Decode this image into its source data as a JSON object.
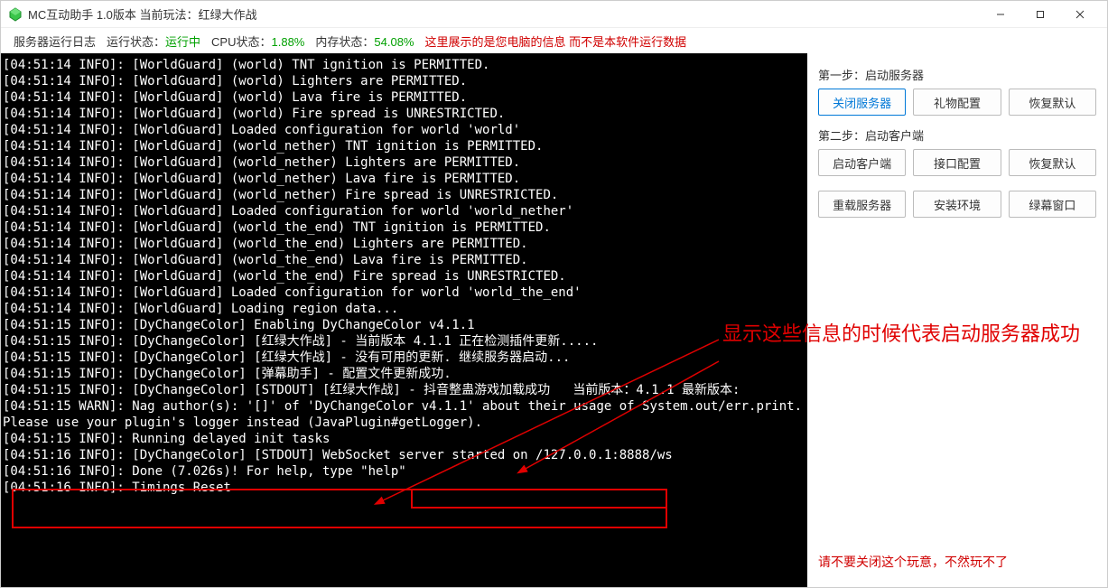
{
  "titlebar": {
    "title": "MC互动助手 1.0版本 当前玩法：红绿大作战"
  },
  "status": {
    "log_title": "服务器运行日志",
    "run_state_label": "运行状态：",
    "run_state_value": "运行中",
    "cpu_label": "CPU状态：",
    "cpu_value": "1.88%",
    "mem_label": "内存状态：",
    "mem_value": "54.08%",
    "notice": "这里展示的是您电脑的信息 而不是本软件运行数据"
  },
  "console_lines": [
    "[04:51:14 INFO]: [WorldGuard] (world) TNT ignition is PERMITTED.",
    "[04:51:14 INFO]: [WorldGuard] (world) Lighters are PERMITTED.",
    "[04:51:14 INFO]: [WorldGuard] (world) Lava fire is PERMITTED.",
    "[04:51:14 INFO]: [WorldGuard] (world) Fire spread is UNRESTRICTED.",
    "[04:51:14 INFO]: [WorldGuard] Loaded configuration for world 'world'",
    "[04:51:14 INFO]: [WorldGuard] (world_nether) TNT ignition is PERMITTED.",
    "[04:51:14 INFO]: [WorldGuard] (world_nether) Lighters are PERMITTED.",
    "[04:51:14 INFO]: [WorldGuard] (world_nether) Lava fire is PERMITTED.",
    "[04:51:14 INFO]: [WorldGuard] (world_nether) Fire spread is UNRESTRICTED.",
    "[04:51:14 INFO]: [WorldGuard] Loaded configuration for world 'world_nether'",
    "[04:51:14 INFO]: [WorldGuard] (world_the_end) TNT ignition is PERMITTED.",
    "[04:51:14 INFO]: [WorldGuard] (world_the_end) Lighters are PERMITTED.",
    "[04:51:14 INFO]: [WorldGuard] (world_the_end) Lava fire is PERMITTED.",
    "[04:51:14 INFO]: [WorldGuard] (world_the_end) Fire spread is UNRESTRICTED.",
    "[04:51:14 INFO]: [WorldGuard] Loaded configuration for world 'world_the_end'",
    "[04:51:14 INFO]: [WorldGuard] Loading region data...",
    "[04:51:15 INFO]: [DyChangeColor] Enabling DyChangeColor v4.1.1",
    "[04:51:15 INFO]: [DyChangeColor] [红绿大作战] - 当前版本 4.1.1 正在检测插件更新.....",
    "[04:51:15 INFO]: [DyChangeColor] [红绿大作战] - 没有可用的更新. 继续服务器启动...",
    "[04:51:15 INFO]: [DyChangeColor] [弹幕助手] - 配置文件更新成功.",
    "[04:51:15 INFO]: [DyChangeColor] [STDOUT] [红绿大作战] - 抖音整蛊游戏加载成功   当前版本：4.1.1 最新版本:",
    "[04:51:15 WARN]: Nag author(s): '[]' of 'DyChangeColor v4.1.1' about their usage of System.out/err.print.",
    "Please use your plugin's logger instead (JavaPlugin#getLogger).",
    "[04:51:15 INFO]: Running delayed init tasks",
    "[04:51:16 INFO]: [DyChangeColor] [STDOUT] WebSocket server started on /127.0.0.1:8888/ws",
    "[04:51:16 INFO]: Done (7.026s)! For help, type \"help\"",
    "[04:51:16 INFO]: Timings Reset"
  ],
  "sidebar": {
    "step1_label": "第一步：启动服务器",
    "step2_label": "第二步：启动客户端",
    "row1": {
      "b1": "关闭服务器",
      "b2": "礼物配置",
      "b3": "恢复默认"
    },
    "row2": {
      "b1": "启动客户端",
      "b2": "接口配置",
      "b3": "恢复默认"
    },
    "row3": {
      "b1": "重载服务器",
      "b2": "安装环境",
      "b3": "绿幕窗口"
    },
    "footer": "请不要关闭这个玩意，不然玩不了"
  },
  "annotation": {
    "text": "显示这些信息的时候代表启动服务器成功"
  },
  "colors": {
    "accent_red": "#e00000",
    "accent_green": "#00a000",
    "highlight_blue": "#0078d7"
  }
}
